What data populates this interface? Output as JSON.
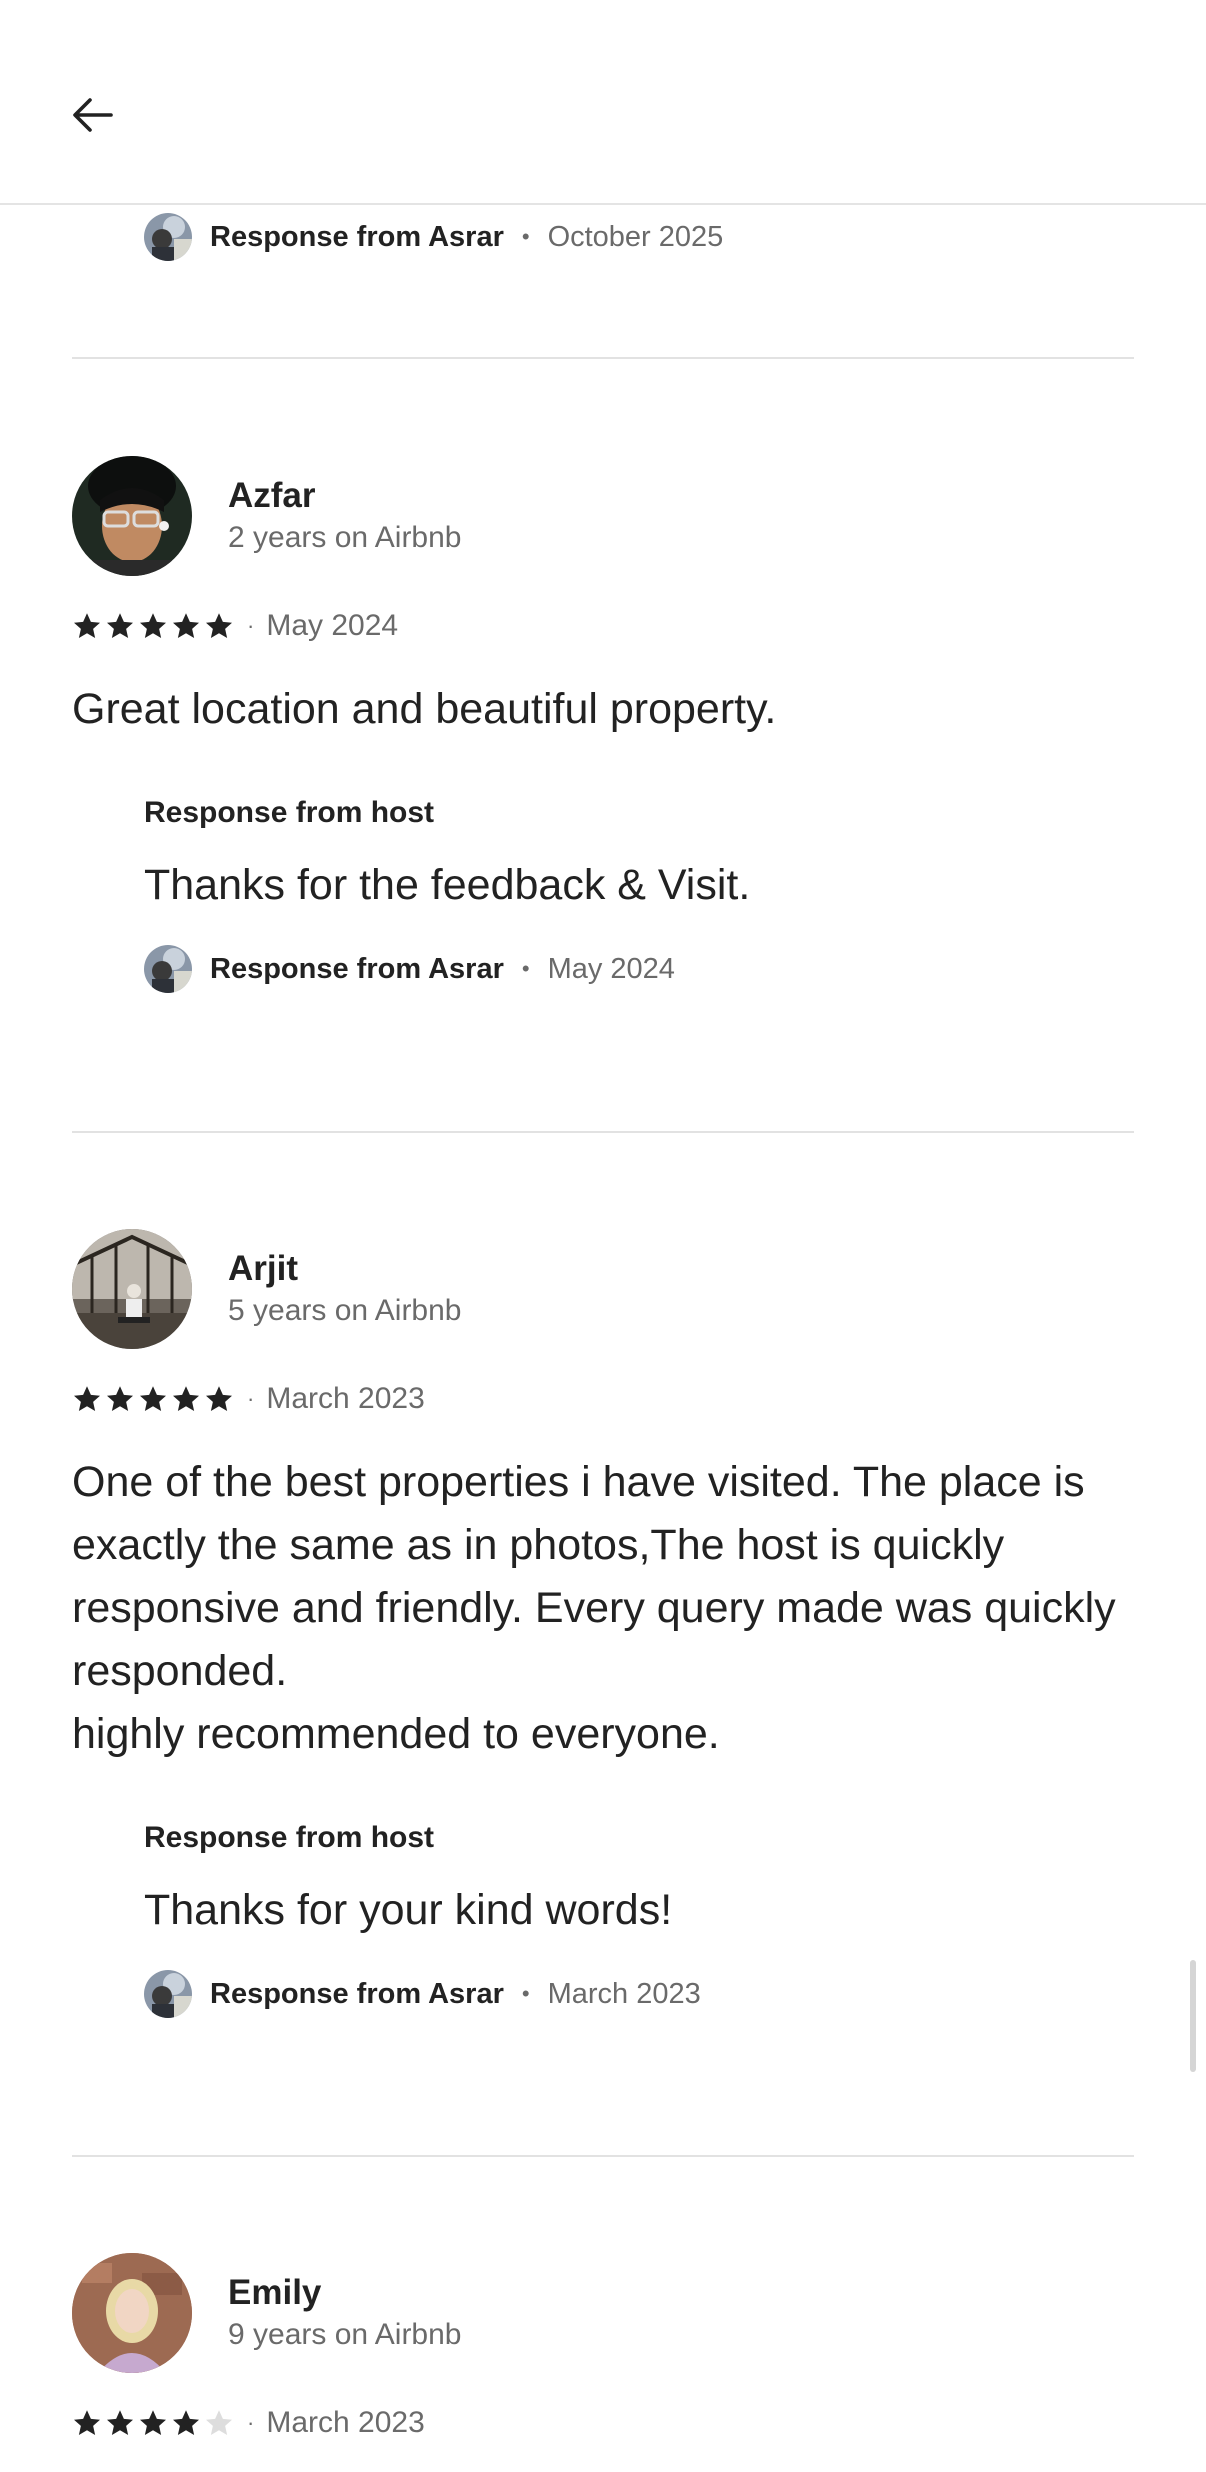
{
  "header": {
    "back_icon": "arrow-left-icon"
  },
  "top_response": {
    "name": "Response from Asrar",
    "date": "October 2025"
  },
  "reviews": [
    {
      "name": "Azfar",
      "meta": "2 years on Airbnb",
      "rating": 5,
      "date": "May 2024",
      "text": "Great location and beautiful property.",
      "host_label": "Response from host",
      "host_text": "Thanks for the feedback & Visit.",
      "response_name": "Response from Asrar",
      "response_date": "May 2024"
    },
    {
      "name": "Arjit",
      "meta": "5 years on Airbnb",
      "rating": 5,
      "date": "March 2023",
      "text": "One of the best properties i have visited. The place is exactly the same as in photos,The host is quickly responsive and friendly. Every query made was quickly responded.\nhighly recommended to everyone.",
      "host_label": "Response from host",
      "host_text": "Thanks for your kind words!",
      "response_name": "Response from Asrar",
      "response_date": "March 2023"
    },
    {
      "name": "Emily",
      "meta": "9 years on Airbnb",
      "rating": 4,
      "date": "March 2023"
    }
  ],
  "separator_dot": "•",
  "rating_separator": "·",
  "colors": {
    "text_primary": "#222222",
    "text_secondary": "#6a6a6a",
    "divider": "#e2e2e2",
    "star_filled": "#222222",
    "star_empty": "#dddddd"
  }
}
